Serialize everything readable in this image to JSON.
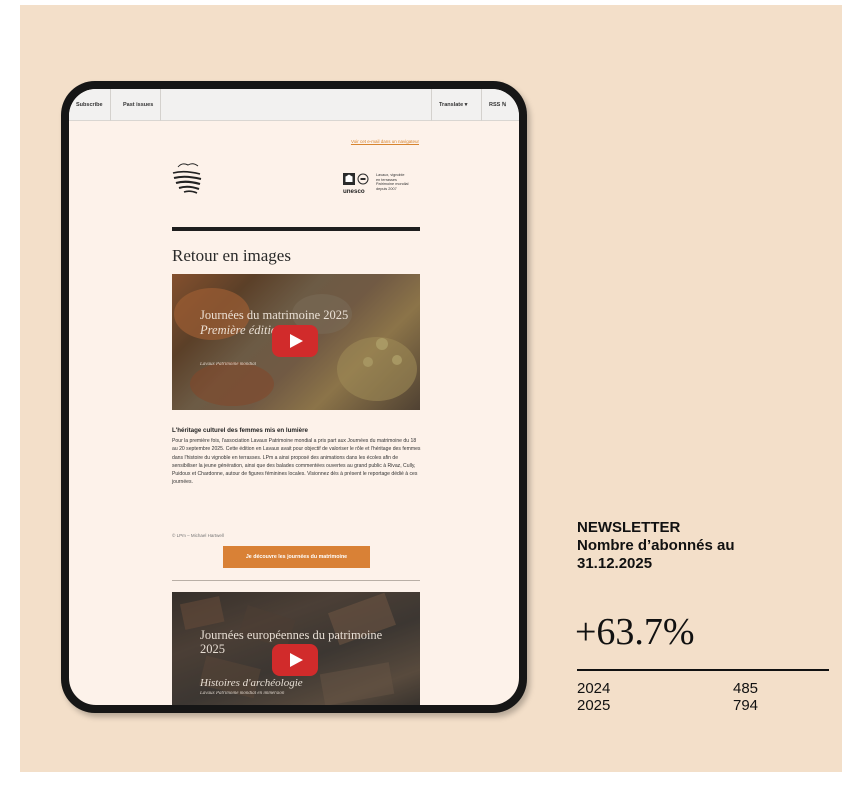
{
  "browser_bar": {
    "left_items": [
      "Subscribe",
      "Past issues"
    ],
    "right_items": [
      "Translate ▾",
      "RSS ℕ"
    ]
  },
  "newsletter": {
    "web_link": "Voir cet e-mail dans un navigateur",
    "unesco_label": "unesco",
    "unesco_text": [
      "Lavaux, vignoble",
      "en terrasses",
      "Patrimoine mondial",
      "depuis 2007"
    ],
    "heading": "Retour en images",
    "video1": {
      "title_line1": "Journées du matrimoine 2025",
      "title_line2": "Première édition",
      "subtitle": "Lavaux Patrimoine mondial"
    },
    "article_title": "L'héritage culturel des femmes mis en lumière",
    "article_body": "Pour la première fois, l'association Lavaux Patrimoine mondial a pris part aux Journées du matrimoine du 18 au 20 septembre 2025. Cette édition en Lavaux avait pour objectif de valoriser le rôle et l'héritage des femmes dans l'histoire du vignoble en terrasses. LPm a ainsi proposé des animations dans les écoles afin de sensibiliser la jeune génération, ainsi que des balades commentées ouvertes au grand public à Rivaz, Cully, Puidoux et Chardonne, autour de figures féminines locales. Visionnez dès à présent le reportage dédié à ces journées.",
    "credit": "© LPm – Michael Hartwell",
    "cta": "Je découvre les journées du matrimoine",
    "video2": {
      "title_line1": "Journées européennes du patrimoine",
      "title_line2": "2025",
      "title_line3": "Histoires d'archéologie",
      "subtitle": "Lavaux Patrimoine mondial en immersion"
    }
  },
  "stats": {
    "label_lines": [
      "NEWSLETTER",
      "Nombre d’abonnés au",
      "31.12.2025"
    ],
    "change": "+63.7%",
    "rows": [
      {
        "year": "2024",
        "value": "485"
      },
      {
        "year": "2025",
        "value": "794"
      }
    ]
  },
  "colors": {
    "background": "#f3dfc9",
    "accent": "#d98136",
    "play_button": "#d12b2b"
  }
}
